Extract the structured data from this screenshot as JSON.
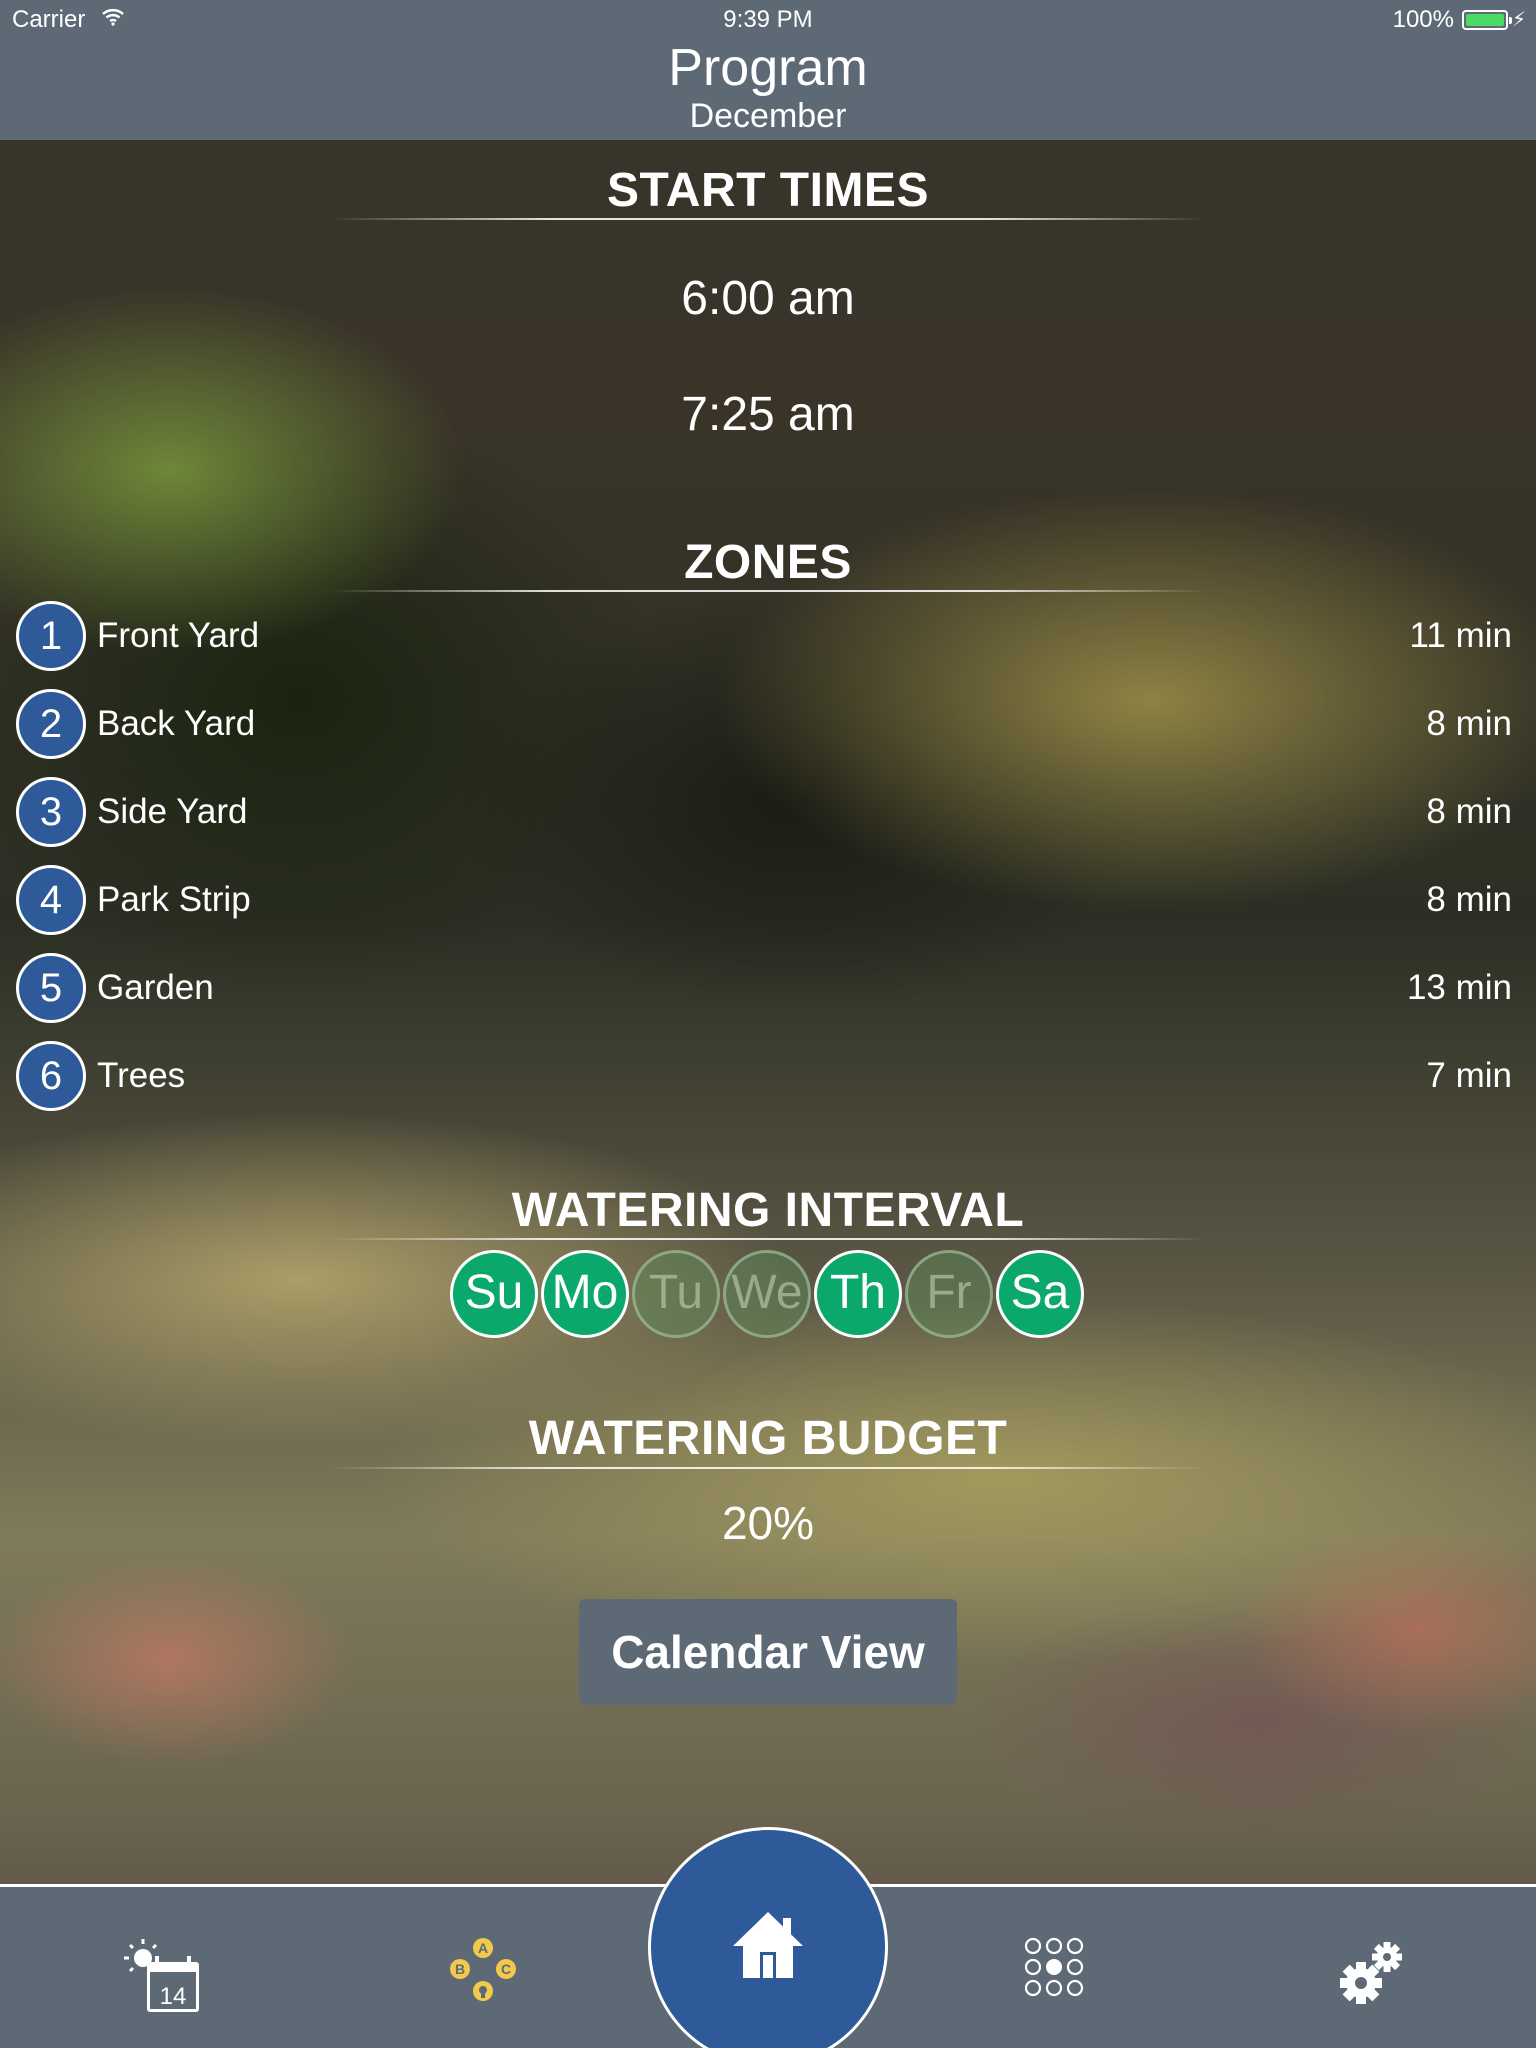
{
  "status_bar": {
    "carrier": "Carrier",
    "time": "9:39 PM",
    "battery": "100%"
  },
  "nav": {
    "title": "Program",
    "subtitle": "December"
  },
  "start_times": {
    "header": "START TIMES",
    "items": [
      "6:00 am",
      "7:25 am"
    ]
  },
  "zones": {
    "header": "ZONES",
    "items": [
      {
        "number": "1",
        "name": "Front Yard",
        "duration": "11 min"
      },
      {
        "number": "2",
        "name": "Back Yard",
        "duration": "8 min"
      },
      {
        "number": "3",
        "name": "Side Yard",
        "duration": "8 min"
      },
      {
        "number": "4",
        "name": "Park Strip",
        "duration": "8 min"
      },
      {
        "number": "5",
        "name": "Garden",
        "duration": "13 min"
      },
      {
        "number": "6",
        "name": "Trees",
        "duration": "7 min"
      }
    ]
  },
  "watering_interval": {
    "header": "WATERING INTERVAL",
    "days": [
      {
        "label": "Su",
        "active": true
      },
      {
        "label": "Mo",
        "active": true
      },
      {
        "label": "Tu",
        "active": false
      },
      {
        "label": "We",
        "active": false
      },
      {
        "label": "Th",
        "active": true
      },
      {
        "label": "Fr",
        "active": false
      },
      {
        "label": "Sa",
        "active": true
      }
    ]
  },
  "watering_budget": {
    "header": "WATERING BUDGET",
    "value": "20%"
  },
  "calendar_button": "Calendar View",
  "tab_bar": {
    "calendar_day": "14",
    "abc_letters": [
      "A",
      "B",
      "C"
    ],
    "icons": [
      "weather-calendar-icon",
      "abc-programs-icon",
      "home-icon",
      "zones-grid-icon",
      "settings-gears-icon"
    ]
  },
  "colors": {
    "bar": "#5d6a75",
    "zone_badge": "#2e5a9a",
    "day_active": "#0aa86b",
    "abc_icon": "#f2c94c"
  }
}
